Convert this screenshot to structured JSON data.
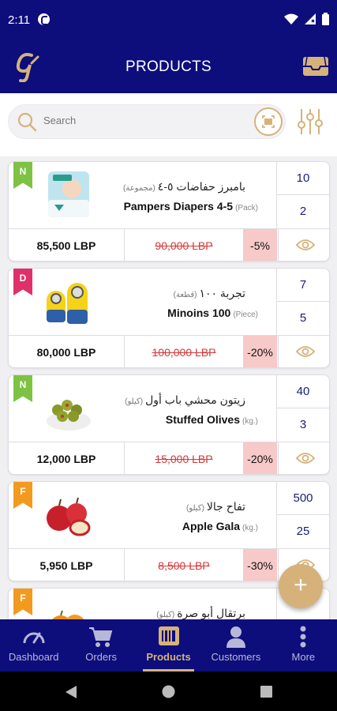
{
  "status_bar": {
    "time": "2:11"
  },
  "header": {
    "title": "PRODUCTS",
    "logo_text": "g"
  },
  "search": {
    "placeholder": "Search"
  },
  "products": [
    {
      "badge": "N",
      "badge_color": "#7dc242",
      "name_ar": "بامبرز حفاضات ٥-٤",
      "unit_ar": "(مجموعة)",
      "name_en": "Pampers Diapers 4-5",
      "unit_en": "(Pack)",
      "qty_top": "10",
      "qty_bottom": "2",
      "price": "85,500 LBP",
      "old_price": "90,000 LBP",
      "discount": "-5%",
      "image": "diaper-pack-image"
    },
    {
      "badge": "D",
      "badge_color": "#e0306b",
      "name_ar": "تجربة ١٠٠",
      "unit_ar": "(قطعة)",
      "name_en": "Minoins 100",
      "unit_en": "(Piece)",
      "qty_top": "7",
      "qty_bottom": "5",
      "price": "80,000 LBP",
      "old_price": "100,000 LBP",
      "discount": "-20%",
      "image": "minion-toy-image"
    },
    {
      "badge": "N",
      "badge_color": "#7dc242",
      "name_ar": "زيتون محشي باب أول",
      "unit_ar": "(كيلو)",
      "name_en": "Stuffed Olives",
      "unit_en": "(kg.)",
      "qty_top": "40",
      "qty_bottom": "3",
      "price": "12,000 LBP",
      "old_price": "15,000 LBP",
      "discount": "-20%",
      "image": "olives-bowl-image"
    },
    {
      "badge": "F",
      "badge_color": "#f39a1e",
      "name_ar": "تفاح جالا",
      "unit_ar": "(كيلو)",
      "name_en": "Apple Gala",
      "unit_en": "(kg.)",
      "qty_top": "500",
      "qty_bottom": "25",
      "price": "5,950 LBP",
      "old_price": "8,500 LBP",
      "discount": "-30%",
      "image": "apples-image"
    },
    {
      "badge": "F",
      "badge_color": "#f39a1e",
      "name_ar": "برتقال أبو صرة",
      "unit_ar": "(كيلو)",
      "name_en": "",
      "unit_en": "",
      "qty_top": "",
      "qty_bottom": "",
      "price": "",
      "old_price": "",
      "discount": "",
      "image": "oranges-image"
    }
  ],
  "fab": {
    "label": "+"
  },
  "nav": [
    {
      "label": "Dashboard",
      "icon": "speedometer-icon"
    },
    {
      "label": "Orders",
      "icon": "cart-icon"
    },
    {
      "label": "Products",
      "icon": "barcode-icon",
      "active": true
    },
    {
      "label": "Customers",
      "icon": "person-icon"
    },
    {
      "label": "More",
      "icon": "more-vertical-icon"
    }
  ],
  "colors": {
    "primary": "#0d0d7c",
    "accent": "#d6b27a",
    "discount_bg": "#f7c9c9",
    "old_price": "#d23a3a",
    "qty_text": "#1a1a7c"
  }
}
